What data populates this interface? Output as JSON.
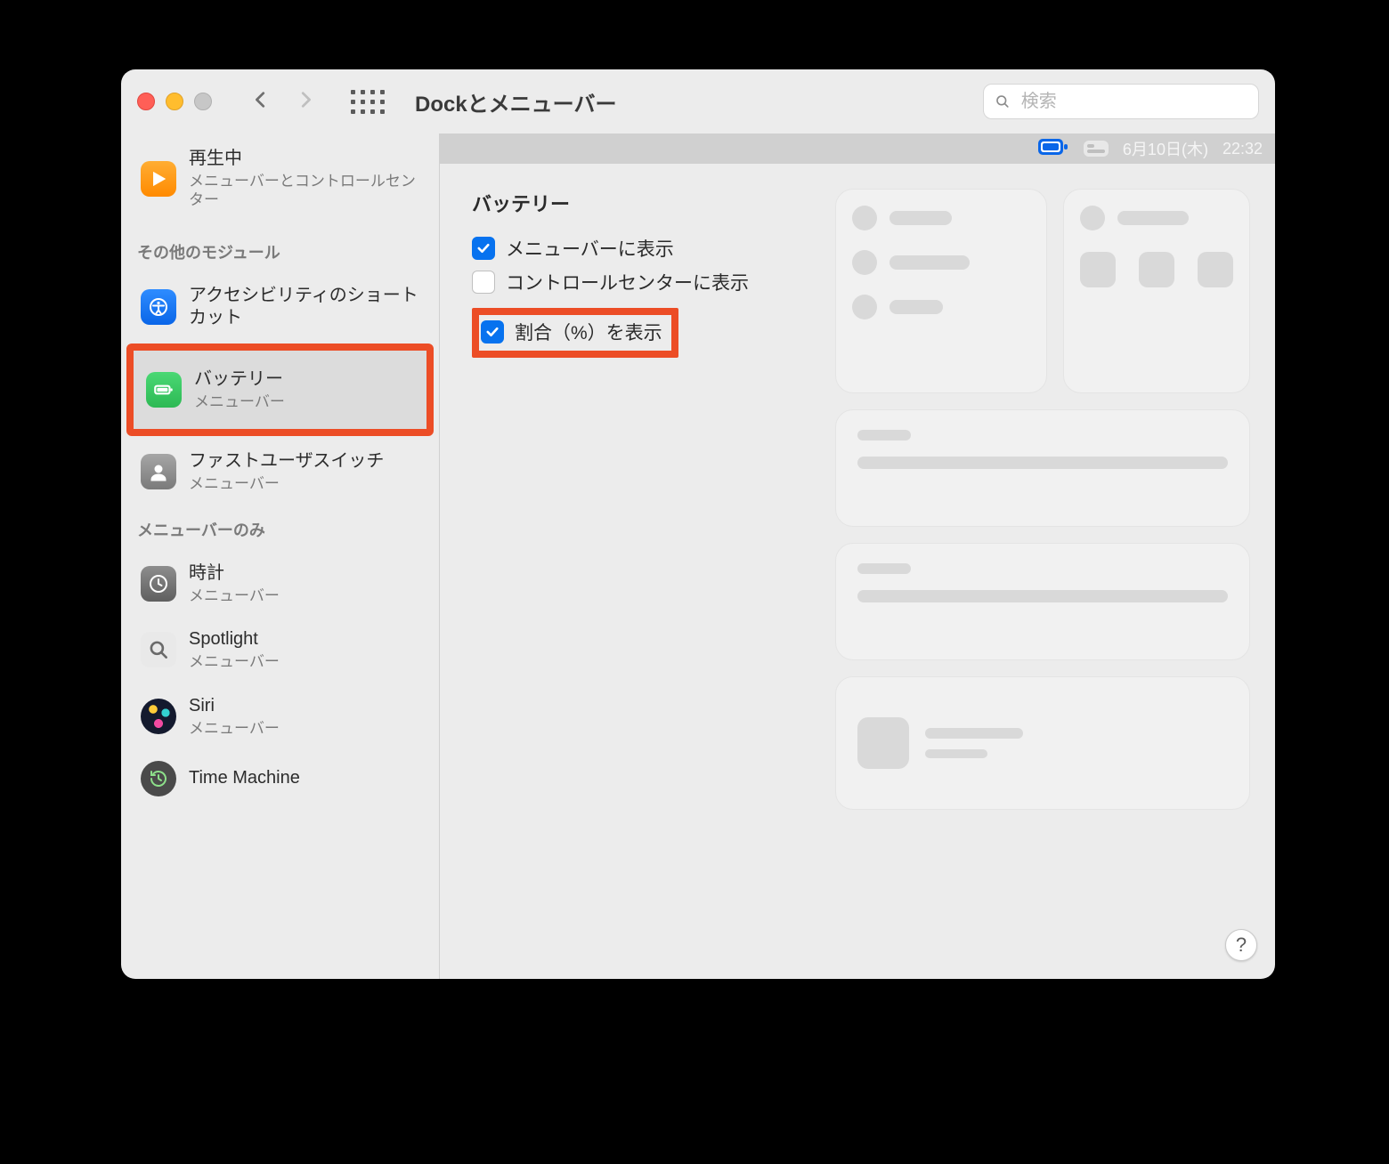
{
  "toolbar": {
    "title": "Dockとメニューバー",
    "search_placeholder": "検索"
  },
  "menubar": {
    "date": "6月10日(木)",
    "time": "22:32"
  },
  "sidebar": {
    "top_item": {
      "label": "再生中",
      "sub": "メニューバーとコントロールセンター"
    },
    "section_other_modules": "その他のモジュール",
    "item_accessibility": {
      "label": "アクセシビリティのショートカット"
    },
    "item_battery": {
      "label": "バッテリー",
      "sub": "メニューバー"
    },
    "item_fastuser": {
      "label": "ファストユーザスイッチ",
      "sub": "メニューバー"
    },
    "section_menubar_only": "メニューバーのみ",
    "item_clock": {
      "label": "時計",
      "sub": "メニューバー"
    },
    "item_spotlight": {
      "label": "Spotlight",
      "sub": "メニューバー"
    },
    "item_siri": {
      "label": "Siri",
      "sub": "メニューバー"
    },
    "item_tm": {
      "label": "Time Machine"
    }
  },
  "settings": {
    "heading": "バッテリー",
    "show_in_menubar": "メニューバーに表示",
    "show_in_cc": "コントロールセンターに表示",
    "show_percentage": "割合（%）を表示"
  },
  "help": "?"
}
